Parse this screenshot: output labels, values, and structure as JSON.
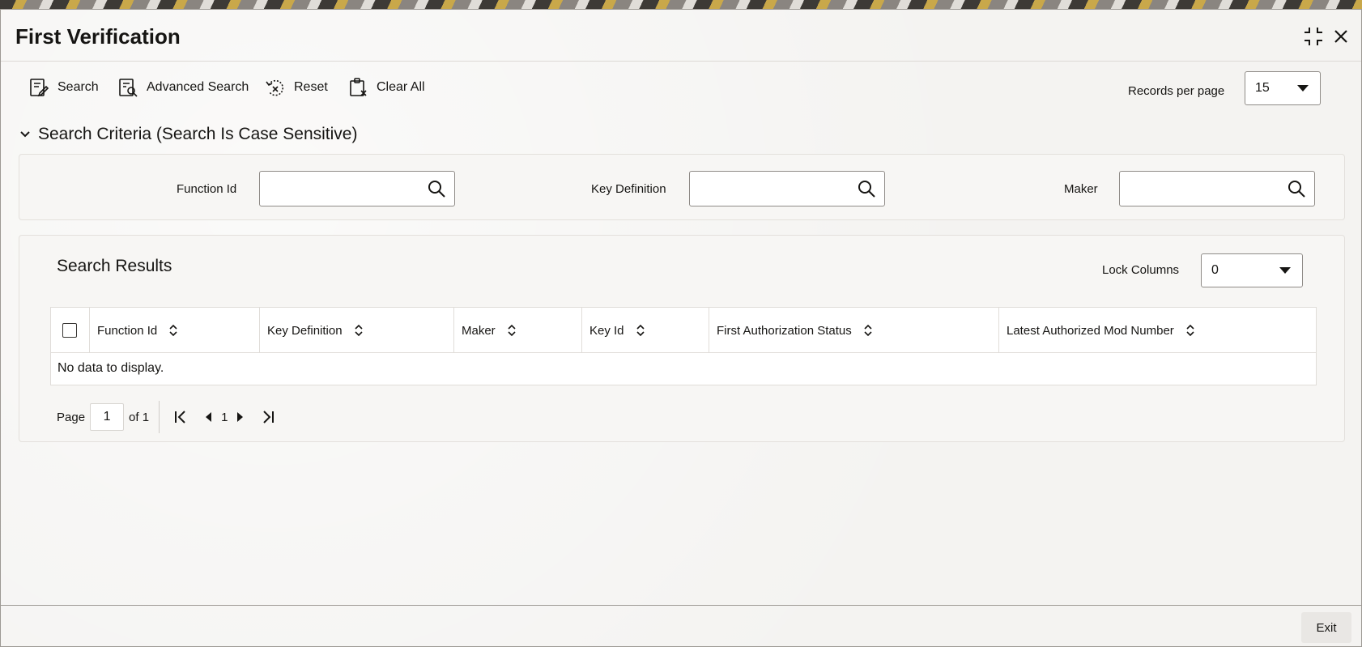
{
  "window": {
    "title": "First Verification"
  },
  "toolbar": {
    "search_label": "Search",
    "advanced_search_label": "Advanced Search",
    "reset_label": "Reset",
    "clear_all_label": "Clear All",
    "records_per_page_label": "Records per page",
    "records_per_page_value": "15"
  },
  "criteria": {
    "heading": "Search Criteria (Search Is Case Sensitive)",
    "function_id_label": "Function Id",
    "function_id_value": "",
    "key_definition_label": "Key Definition",
    "key_definition_value": "",
    "maker_label": "Maker",
    "maker_value": ""
  },
  "results": {
    "heading": "Search Results",
    "lock_columns_label": "Lock Columns",
    "lock_columns_value": "0",
    "columns": [
      "Function Id",
      "Key Definition",
      "Maker",
      "Key Id",
      "First Authorization Status",
      "Latest Authorized Mod Number"
    ],
    "empty_message": "No data to display.",
    "pager": {
      "page_label": "Page",
      "current_page": "1",
      "of_label": "of 1",
      "page_number": "1"
    }
  },
  "footer": {
    "exit_label": "Exit"
  },
  "colors": {
    "text": "#161513",
    "border": "#8f8b87",
    "panel": "#f7f6f4"
  }
}
